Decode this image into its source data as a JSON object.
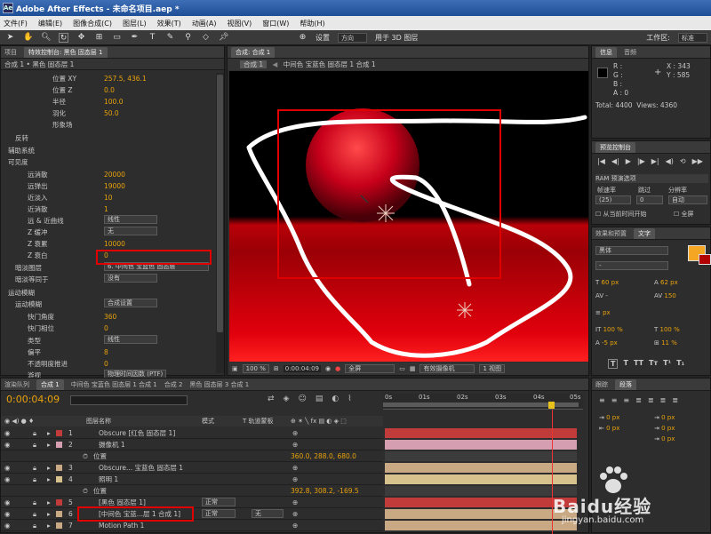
{
  "window": {
    "title": "Adobe After Effects - 未命名项目.aep *",
    "app_icon": "Ae"
  },
  "menu": [
    "文件(F)",
    "编辑(E)",
    "图像合成(C)",
    "图层(L)",
    "效果(T)",
    "动画(A)",
    "视图(V)",
    "窗口(W)",
    "帮助(H)"
  ],
  "toolbar": {
    "settings_label": "设置",
    "direction_value": "方向",
    "threed_label": "用于 3D 图层",
    "workspace_label": "工作区:",
    "workspace_value": "标准"
  },
  "effect_panel": {
    "tabs": [
      "项目",
      "特效控制台: 黑色 固态层 1"
    ],
    "breadcrumb": "合成 1 • 黑色 固态层 1",
    "rows": [
      {
        "label": "位置 XY",
        "value": "257.5, 436.1"
      },
      {
        "label": "位置 Z",
        "value": "0.0"
      },
      {
        "label": "半径",
        "value": "100.0"
      },
      {
        "label": "羽化",
        "value": "50.0"
      },
      {
        "label": "形象场",
        "value": ""
      },
      {
        "label": "反转",
        "value": ""
      },
      {
        "label": "辅助系统",
        "value": ""
      },
      {
        "label": "可见度",
        "value": ""
      },
      {
        "label": "远消散",
        "value": "20000"
      },
      {
        "label": "远弹出",
        "value": "19000"
      },
      {
        "label": "近淡入",
        "value": "10"
      },
      {
        "label": "近消散",
        "value": "1"
      },
      {
        "label": "远 & 近曲线",
        "value": "线性"
      },
      {
        "label": "Z 缓冲",
        "value": "无"
      },
      {
        "label": "Z 衰累",
        "value": "10000"
      },
      {
        "label": "Z 衰白",
        "value": "0"
      },
      {
        "label": "暗淡图层",
        "value": "6. 中间色 宝蓝色 固态层"
      },
      {
        "label": "暗淡等同于",
        "value": "没有"
      },
      {
        "label": "运动模糊",
        "value": ""
      },
      {
        "label": "运动模糊",
        "value": "合成设置"
      },
      {
        "label": "快门角度",
        "value": "360"
      },
      {
        "label": "快门相位",
        "value": "0"
      },
      {
        "label": "类型",
        "value": "线性"
      },
      {
        "label": "偏平",
        "value": "8"
      },
      {
        "label": "不透明度推进",
        "value": "0"
      },
      {
        "label": "游视",
        "value": "物理时间因数 (PTF)"
      },
      {
        "label": "渲染模式",
        "value": "全部渲染"
      }
    ]
  },
  "comp_panel": {
    "tab": "合成: 合成 1",
    "breadcrumb": [
      "合成 1",
      "中间色 宝蓝色 固态层 1 合成 1"
    ],
    "zoom": "100 %",
    "timecode": "0:00:04:09",
    "resolution": "全屏",
    "camera": "有效摄像机",
    "views": "1 视图"
  },
  "info_panel": {
    "tabs": [
      "信息",
      "音频"
    ],
    "r": "R :",
    "g": "G :",
    "b": "B :",
    "a": "A : 0",
    "x": "X : 343",
    "y": "Y : 585",
    "total": "Total: 4400",
    "stats": "Views: 4360"
  },
  "preview_panel": {
    "tab": "预览控制台",
    "ram": "RAM 预演选项",
    "frame_rate_label": "帧速率",
    "frame_rate": "(25)",
    "skip_label": "跳过",
    "skip": "0",
    "resolution_label": "分辨率",
    "resolution": "自动",
    "from_current": "从当前时间开始",
    "fullscreen": "全屏"
  },
  "char_panel": {
    "tabs": [
      "效果和预置",
      "文字"
    ],
    "font": "黑体",
    "style": "-",
    "size": "60 px",
    "leading": "62 px",
    "tracking": "150",
    "vscale": "100 %",
    "hscale": "100 %",
    "baseline": "-5 px",
    "tsume": "11 %",
    "px_label": "px",
    "pct_label": "%"
  },
  "timeline": {
    "tabs": [
      "渲染队列",
      "合成 1",
      "中间色 宝蓝色 固态层 1 合成 1",
      "合成 2",
      "黑色 固态层 3 合成 1"
    ],
    "timecode": "0:00:04:09",
    "search_placeholder": "",
    "headers": {
      "layer_name": "图层名称",
      "mode": "模式",
      "trkmat": "T 轨道蒙板"
    },
    "ruler": [
      "0s",
      "01s",
      "02s",
      "03s",
      "04s",
      "05s"
    ],
    "layers": [
      {
        "num": "1",
        "name": "Obscure [红色 固态层 1]",
        "color": "#c23b3b",
        "mode": "",
        "sub": ""
      },
      {
        "num": "2",
        "name": "摄像机 1",
        "color": "#d69eb1",
        "mode": "",
        "sub": "位置",
        "subval": "360.0, 288.0, 680.0"
      },
      {
        "num": "3",
        "name": "Obscure... 宝蓝色 固态层 1",
        "color": "#c8a983",
        "mode": "",
        "sub": ""
      },
      {
        "num": "4",
        "name": "照明 1",
        "color": "#d7c28d",
        "mode": "",
        "sub": "位置",
        "subval": "392.8, 308.2, -169.5"
      },
      {
        "num": "5",
        "name": "[黑色 固态层 1]",
        "color": "#c23b3b",
        "mode": "正常",
        "sub": ""
      },
      {
        "num": "6",
        "name": "[中间色 宝蓝...层 1 合成 1]",
        "color": "#c8a983",
        "mode": "正常",
        "trk": "无",
        "sub": ""
      },
      {
        "num": "7",
        "name": "Motion Path 1",
        "color": "#c8a983",
        "mode": "",
        "sub": ""
      }
    ]
  },
  "align_panel": {
    "tabs": [
      "跟踪",
      "段落"
    ],
    "vals": [
      "0 px",
      "0 px",
      "0 px",
      "0 px",
      "0 px"
    ]
  },
  "watermark": {
    "brand": "Baidu经验",
    "url": "jingyan.baidu.com"
  }
}
